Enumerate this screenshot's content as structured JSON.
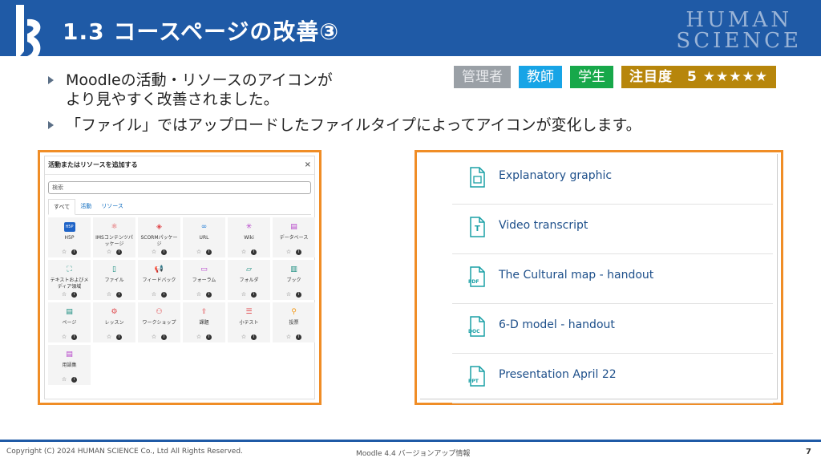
{
  "header": {
    "title": "1.3 コースページの改善③",
    "brand_line1": "HUMAN",
    "brand_line2": "SCIENCE"
  },
  "bullets": [
    {
      "line1": "Moodleの活動・リソースのアイコンが",
      "line2": "より見やすく改善されました。"
    },
    {
      "line1": "「ファイル」ではアップロードしたファイルタイプによってアイコンが変化します。"
    }
  ],
  "badges": {
    "admin": "管理者",
    "teacher": "教師",
    "student": "学生",
    "attention": "注目度　5 ★★★★★"
  },
  "chooser": {
    "title": "活動またはリソースを追加する",
    "close": "×",
    "search_placeholder": "検索",
    "tabs": [
      "すべて",
      "活動",
      "リソース"
    ],
    "items": [
      {
        "label": "H5P",
        "icon": "h5p-icon",
        "glyph": "H5P",
        "color": "#1e63c7"
      },
      {
        "label": "IMSコンテンツパッケージ",
        "icon": "package-icon",
        "glyph": "⚛",
        "color": "#e0464a"
      },
      {
        "label": "SCORMパッケージ",
        "icon": "box-icon",
        "glyph": "◈",
        "color": "#e0464a"
      },
      {
        "label": "URL",
        "icon": "link-icon",
        "glyph": "∞",
        "color": "#1f7bd6"
      },
      {
        "label": "Wiki",
        "icon": "network-icon",
        "glyph": "✳",
        "color": "#b441c9"
      },
      {
        "label": "データベース",
        "icon": "database-icon",
        "glyph": "▤",
        "color": "#b441c9"
      },
      {
        "label": "テキストおよびメディア領域",
        "icon": "media-icon",
        "glyph": "⛶",
        "color": "#148a7c"
      },
      {
        "label": "ファイル",
        "icon": "file-icon",
        "glyph": "▯",
        "color": "#148a7c"
      },
      {
        "label": "フィードバック",
        "icon": "megaphone-icon",
        "glyph": "📢",
        "color": "#f39a1b"
      },
      {
        "label": "フォーラム",
        "icon": "forum-icon",
        "glyph": "▭",
        "color": "#b441c9"
      },
      {
        "label": "フォルダ",
        "icon": "folder-icon",
        "glyph": "▱",
        "color": "#148a7c"
      },
      {
        "label": "ブック",
        "icon": "book-icon",
        "glyph": "▥",
        "color": "#148a7c"
      },
      {
        "label": "ページ",
        "icon": "page-icon",
        "glyph": "▤",
        "color": "#148a7c"
      },
      {
        "label": "レッスン",
        "icon": "lesson-icon",
        "glyph": "⚙",
        "color": "#e0464a"
      },
      {
        "label": "ワークショップ",
        "icon": "workshop-icon",
        "glyph": "⚇",
        "color": "#e0464a"
      },
      {
        "label": "課題",
        "icon": "assignment-icon",
        "glyph": "⇪",
        "color": "#e0464a"
      },
      {
        "label": "小テスト",
        "icon": "quiz-icon",
        "glyph": "☰",
        "color": "#e0464a"
      },
      {
        "label": "投票",
        "icon": "choice-icon",
        "glyph": "⚲",
        "color": "#f39a1b"
      },
      {
        "label": "用語集",
        "icon": "glossary-icon",
        "glyph": "▤",
        "color": "#b441c9"
      }
    ]
  },
  "files": [
    {
      "name": "Explanatory graphic",
      "icon": "image-file-icon",
      "tag": ""
    },
    {
      "name": "Video transcript",
      "icon": "text-file-icon",
      "tag": "T"
    },
    {
      "name": "The Cultural map - handout",
      "icon": "pdf-file-icon",
      "tag": "PDF"
    },
    {
      "name": "6-D model - handout",
      "icon": "doc-file-icon",
      "tag": "DOC"
    },
    {
      "name": "Presentation April 22",
      "icon": "ppt-file-icon",
      "tag": "PPT"
    }
  ],
  "footer": {
    "copyright": "Copyright (C) 2024 HUMAN SCIENCE Co., Ltd All Rights Reserved.",
    "doc_title": "Moodle 4.4 バージョンアップ情報",
    "page": "7"
  },
  "colors": {
    "header": "#1f5aa6",
    "frame": "#f08d26",
    "file_icon": "#1aa0a6"
  }
}
